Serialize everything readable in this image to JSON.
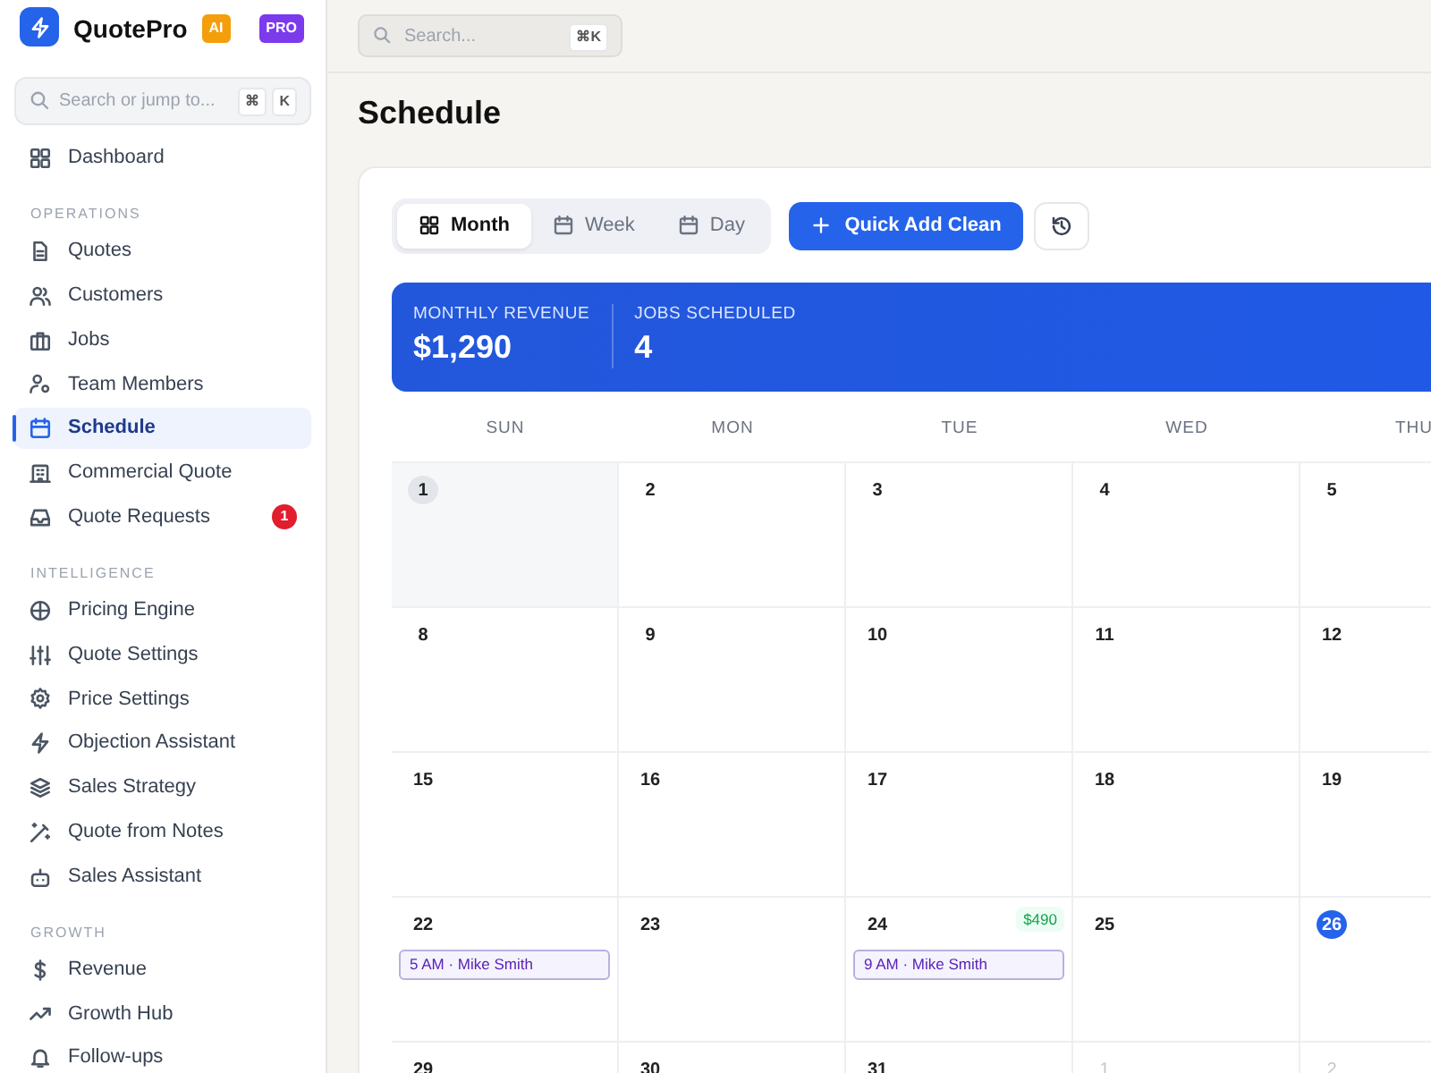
{
  "sidebar": {
    "brand": "QuotePro",
    "ai_badge": "AI",
    "pro_badge": "PRO",
    "search": {
      "placeholder": "Search or jump to...",
      "keys": [
        "⌘",
        "K"
      ]
    },
    "sections": [
      {
        "items": [
          {
            "label": "Dashboard",
            "selected": false
          }
        ]
      },
      {
        "title": "OPERATIONS",
        "items": [
          {
            "label": "Quotes",
            "selected": false
          },
          {
            "label": "Customers",
            "selected": false
          },
          {
            "label": "Jobs",
            "selected": false
          },
          {
            "label": "Team Members",
            "selected": false
          },
          {
            "label": "Schedule",
            "selected": true
          },
          {
            "label": "Commercial Quote",
            "selected": false
          },
          {
            "label": "Quote Requests",
            "selected": false,
            "badge": "1"
          }
        ]
      },
      {
        "title": "INTELLIGENCE",
        "items": [
          {
            "label": "Pricing Engine",
            "selected": false
          },
          {
            "label": "Quote Settings",
            "selected": false
          },
          {
            "label": "Price Settings",
            "selected": false
          },
          {
            "label": "Objection Assistant",
            "selected": false
          },
          {
            "label": "Sales Strategy",
            "selected": false
          },
          {
            "label": "Quote from Notes",
            "selected": false
          },
          {
            "label": "Sales Assistant",
            "selected": false
          }
        ]
      },
      {
        "title": "GROWTH",
        "items": [
          {
            "label": "Revenue",
            "selected": false
          },
          {
            "label": "Growth Hub",
            "selected": false
          },
          {
            "label": "Follow-ups",
            "selected": false
          }
        ]
      }
    ]
  },
  "topbar": {
    "search": {
      "placeholder": "Search...",
      "shortcut": "⌘K"
    }
  },
  "page_title": "Schedule",
  "view_tabs": [
    {
      "label": "Month",
      "selected": true
    },
    {
      "label": "Week",
      "selected": false
    },
    {
      "label": "Day",
      "selected": false
    }
  ],
  "quick_add_button": "Quick Add Clean",
  "stats": [
    {
      "label": "MONTHLY REVENUE",
      "value": "$1,290"
    },
    {
      "label": "JOBS SCHEDULED",
      "value": "4"
    }
  ],
  "calendar": {
    "weekdays": [
      "SUN",
      "MON",
      "TUE",
      "WED",
      "THU"
    ],
    "weeks": [
      [
        {
          "day": "1",
          "kind": "selected"
        },
        {
          "day": "2",
          "kind": "normal"
        },
        {
          "day": "3",
          "kind": "normal"
        },
        {
          "day": "4",
          "kind": "normal"
        },
        {
          "day": "5",
          "kind": "normal"
        }
      ],
      [
        {
          "day": "8",
          "kind": "normal"
        },
        {
          "day": "9",
          "kind": "normal"
        },
        {
          "day": "10",
          "kind": "normal"
        },
        {
          "day": "11",
          "kind": "normal"
        },
        {
          "day": "12",
          "kind": "normal"
        }
      ],
      [
        {
          "day": "15",
          "kind": "normal"
        },
        {
          "day": "16",
          "kind": "normal"
        },
        {
          "day": "17",
          "kind": "normal"
        },
        {
          "day": "18",
          "kind": "normal"
        },
        {
          "day": "19",
          "kind": "normal"
        }
      ],
      [
        {
          "day": "22",
          "kind": "normal",
          "events": [
            "5 AM · Mike Smith"
          ]
        },
        {
          "day": "23",
          "kind": "normal"
        },
        {
          "day": "24",
          "kind": "normal",
          "revenue": "$490",
          "events": [
            "9 AM · Mike Smith"
          ]
        },
        {
          "day": "25",
          "kind": "normal"
        },
        {
          "day": "26",
          "kind": "today"
        }
      ],
      [
        {
          "day": "29",
          "kind": "normal"
        },
        {
          "day": "30",
          "kind": "normal"
        },
        {
          "day": "31",
          "kind": "normal"
        },
        {
          "day": "1",
          "kind": "other_month"
        },
        {
          "day": "2",
          "kind": "other_month"
        }
      ]
    ]
  }
}
